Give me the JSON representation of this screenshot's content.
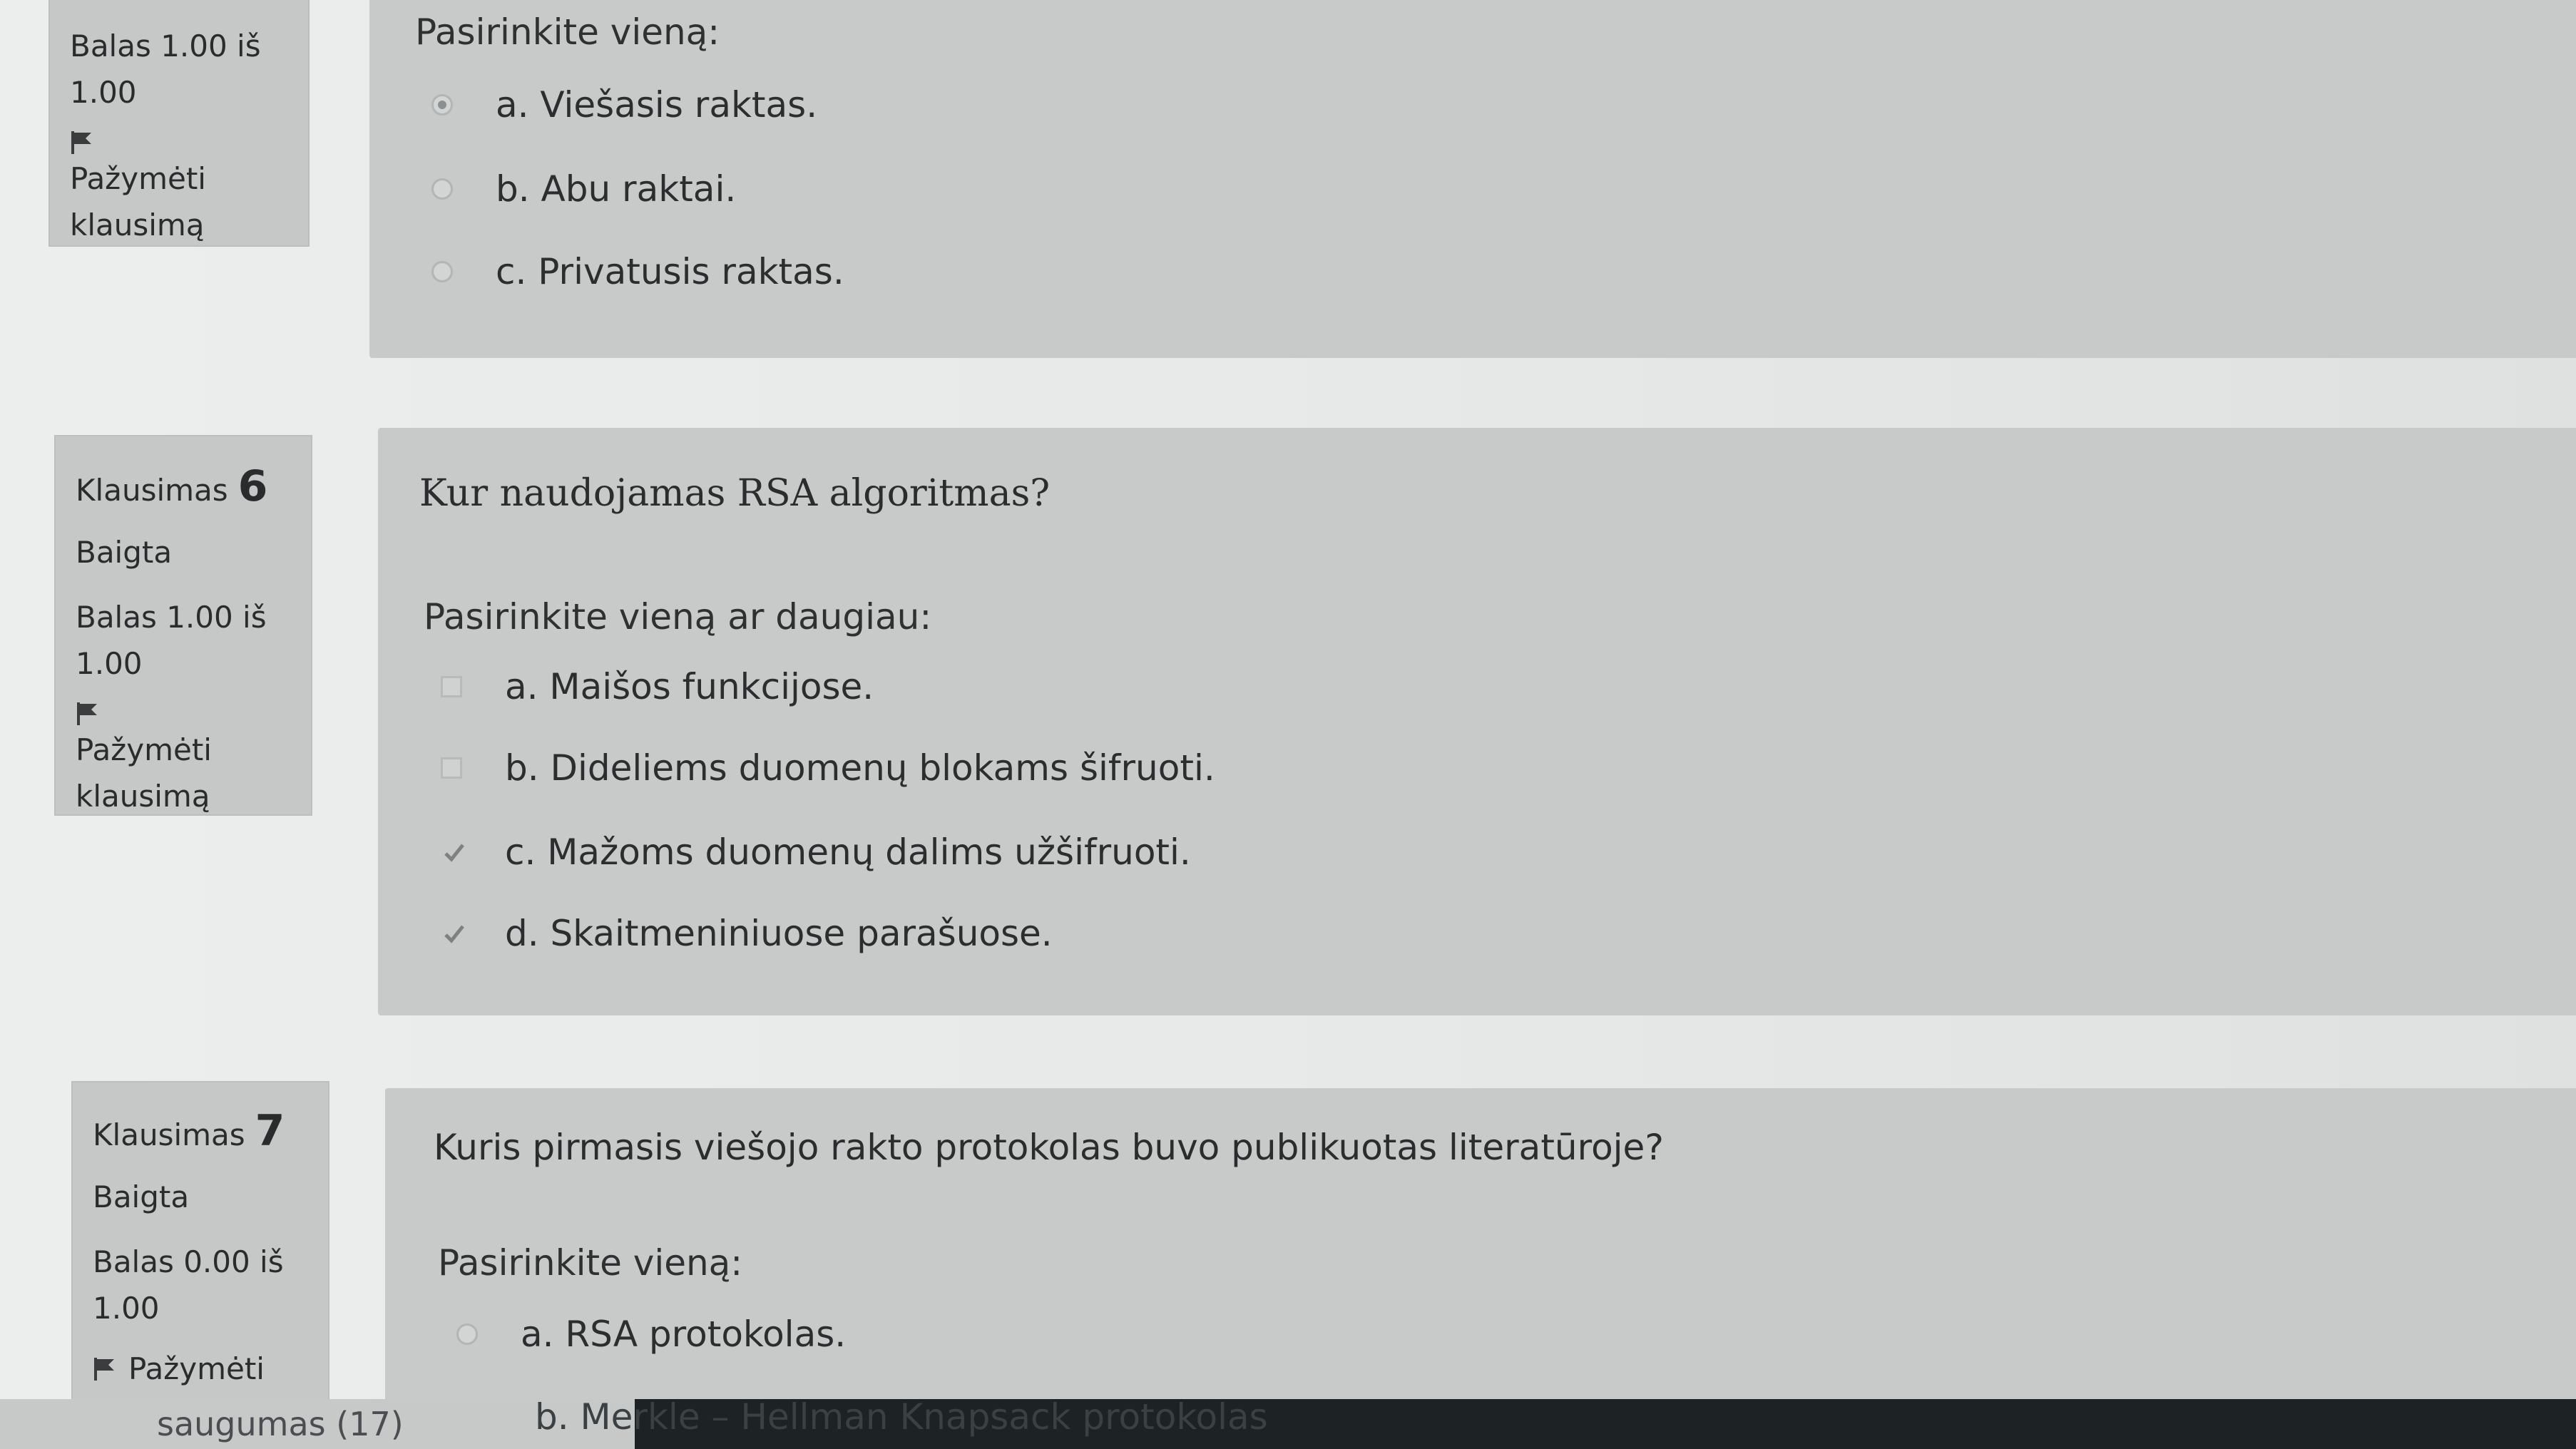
{
  "questions": [
    {
      "grade": "Balas 1.00 iš 1.00",
      "flag_label": "Pažymėti klausimą",
      "prompt": "Pasirinkite vieną:",
      "answers": [
        {
          "label": "a. Viešasis raktas.",
          "selected": true
        },
        {
          "label": "b. Abu raktai.",
          "selected": false
        },
        {
          "label": "c. Privatusis raktas.",
          "selected": false
        }
      ]
    },
    {
      "word": "Klausimas",
      "number": "6",
      "state": "Baigta",
      "grade": "Balas 1.00 iš 1.00",
      "flag_label": "Pažymėti klausimą",
      "text": "Kur naudojamas RSA algoritmas?",
      "prompt": "Pasirinkite vieną ar daugiau:",
      "answers": [
        {
          "label": "a. Maišos funkcijose.",
          "selected": false
        },
        {
          "label": "b. Dideliems duomenų blokams šifruoti.",
          "selected": false
        },
        {
          "label": "c. Mažoms duomenų dalims užšifruoti.",
          "selected": true
        },
        {
          "label": "d. Skaitmeniniuose parašuose.",
          "selected": true
        }
      ]
    },
    {
      "word": "Klausimas",
      "number": "7",
      "state": "Baigta",
      "grade": "Balas 0.00 iš 1.00",
      "flag_label": "Pažymėti",
      "text": "Kuris pirmasis viešojo rakto protokolas buvo publikuotas literatūroje?",
      "prompt": "Pasirinkite vieną:",
      "answers": [
        {
          "label": "a. RSA protokolas.",
          "selected": false
        },
        {
          "label": "b. Merkle – Hellman Knapsack protokolas",
          "selected": true
        }
      ]
    }
  ],
  "bottom_bar": {
    "nav_text": "saugumas (17)"
  },
  "colors": {
    "card": "#c6c8c8",
    "panel": "#c8caca",
    "text": "#2b2d2e",
    "bottom_bar": "#1d2324"
  }
}
